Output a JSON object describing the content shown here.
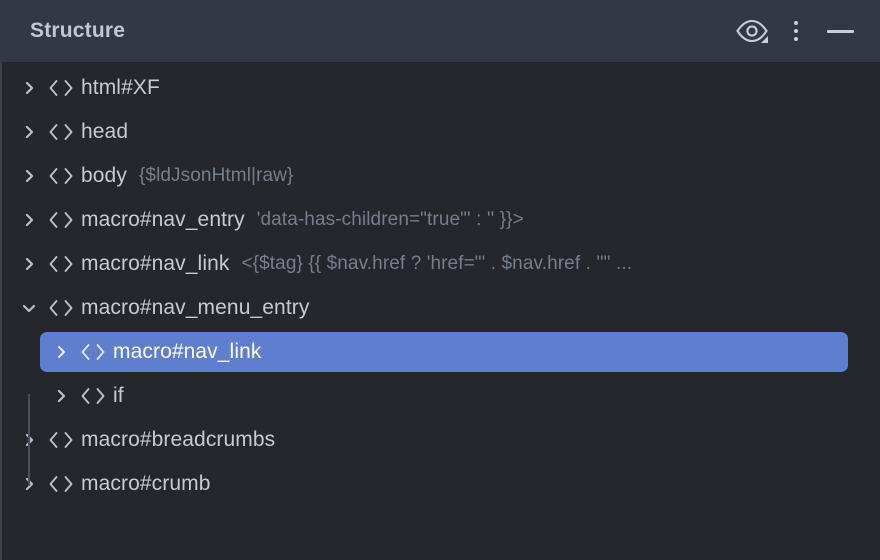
{
  "header": {
    "title": "Structure",
    "actions": [
      {
        "name": "eye-icon",
        "label": "Toggle visibility filter"
      },
      {
        "name": "kebab-menu-icon",
        "label": "More options"
      },
      {
        "name": "minimize-icon",
        "label": "Minimize"
      }
    ]
  },
  "tree": {
    "rows": [
      {
        "label": "html#XF",
        "secondary": "",
        "depth": 0,
        "expanded": false,
        "selected": false
      },
      {
        "label": "head",
        "secondary": "",
        "depth": 0,
        "expanded": false,
        "selected": false
      },
      {
        "label": "body",
        "secondary": "{$ldJsonHtml|raw}",
        "depth": 0,
        "expanded": false,
        "selected": false
      },
      {
        "label": "macro#nav_entry",
        "secondary": "'data-has-children=\"true\"' : '' }}>",
        "depth": 0,
        "expanded": false,
        "selected": false
      },
      {
        "label": "macro#nav_link",
        "secondary": "<{$tag} {{ $nav.href ? 'href=\"' . $nav.href . '\"' ...",
        "depth": 0,
        "expanded": false,
        "selected": false
      },
      {
        "label": "macro#nav_menu_entry",
        "secondary": "",
        "depth": 0,
        "expanded": true,
        "selected": false
      },
      {
        "label": "macro#nav_link",
        "secondary": "",
        "depth": 1,
        "expanded": false,
        "selected": true
      },
      {
        "label": "if",
        "secondary": "",
        "depth": 1,
        "expanded": false,
        "selected": false
      },
      {
        "label": "macro#breadcrumbs",
        "secondary": "",
        "depth": 0,
        "expanded": false,
        "selected": false
      },
      {
        "label": "macro#crumb",
        "secondary": "",
        "depth": 0,
        "expanded": false,
        "selected": false
      }
    ]
  },
  "colors": {
    "header_bg": "#343845",
    "panel_bg": "#25272d",
    "selection": "#5f7ece",
    "text_primary": "#c5cad3",
    "text_secondary": "#767e8c"
  }
}
